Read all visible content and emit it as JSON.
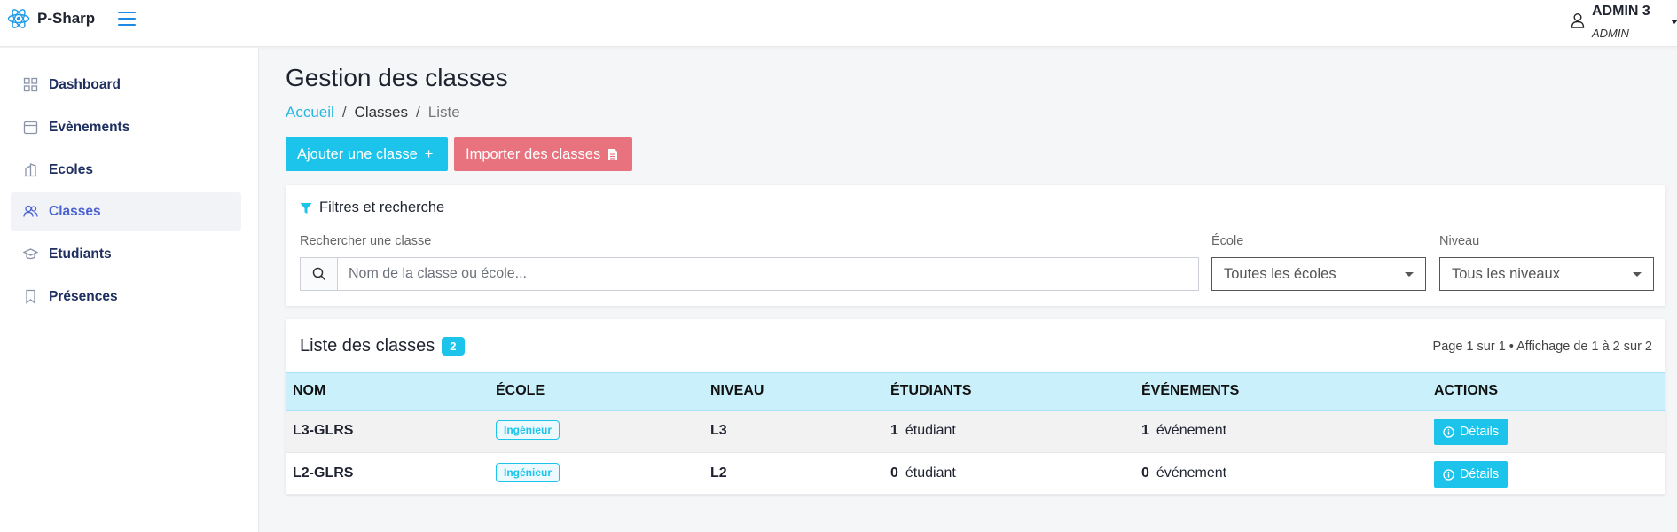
{
  "app": {
    "name": "P-Sharp",
    "logo_icon": "react-atom-icon",
    "accent": "#1cc4ec"
  },
  "user": {
    "name": "ADMIN 3",
    "role": "ADMIN"
  },
  "sidebar": {
    "items": [
      {
        "label": "Dashboard",
        "icon": "dashboard-grid-icon",
        "active": false
      },
      {
        "label": "Evènements",
        "icon": "calendar-icon",
        "active": false
      },
      {
        "label": "Ecoles",
        "icon": "building-icon",
        "active": false
      },
      {
        "label": "Classes",
        "icon": "users-icon",
        "active": true
      },
      {
        "label": "Etudiants",
        "icon": "graduation-cap-icon",
        "active": false
      },
      {
        "label": "Présences",
        "icon": "bookmark-icon",
        "active": false
      }
    ]
  },
  "page": {
    "title": "Gestion des classes",
    "breadcrumb": [
      "Accueil",
      "Classes",
      "Liste"
    ]
  },
  "actions": {
    "add_label": "Ajouter une classe",
    "add_symbol": "+",
    "import_label": "Importer des classes"
  },
  "filters": {
    "title": "Filtres et recherche",
    "search_label": "Rechercher une classe",
    "search_placeholder": "Nom de la classe ou école...",
    "school_label": "École",
    "school_value": "Toutes les écoles",
    "level_label": "Niveau",
    "level_value": "Tous les niveaux"
  },
  "list": {
    "title": "Liste des classes",
    "count": "2",
    "pagination": "Page 1 sur 1 • Affichage de 1 à 2 sur 2",
    "columns": [
      "NOM",
      "ÉCOLE",
      "NIVEAU",
      "ÉTUDIANTS",
      "ÉVÉNEMENTS",
      "ACTIONS"
    ],
    "rows": [
      {
        "name": "L3-GLRS",
        "school": "Ingénieur",
        "level": "L3",
        "students": "1",
        "students_unit": "étudiant",
        "events": "1",
        "events_unit": "événement",
        "action": "Détails"
      },
      {
        "name": "L2-GLRS",
        "school": "Ingénieur",
        "level": "L2",
        "students": "0",
        "students_unit": "étudiant",
        "events": "0",
        "events_unit": "événement",
        "action": "Détails"
      }
    ]
  }
}
